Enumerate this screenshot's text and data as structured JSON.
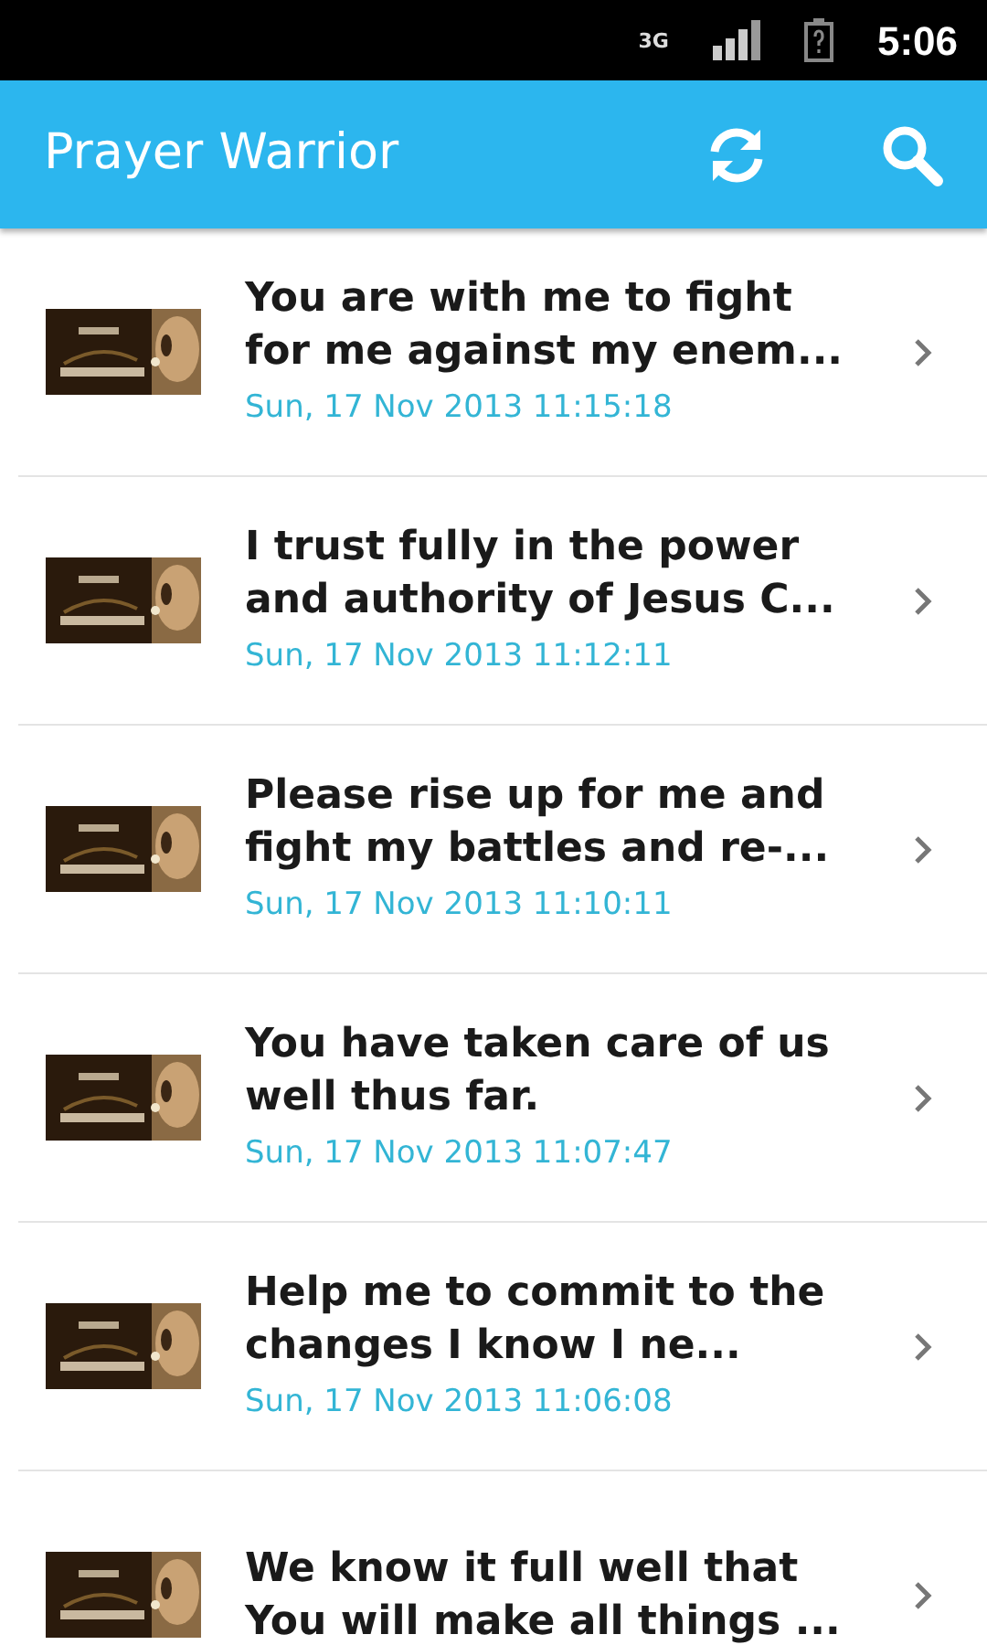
{
  "status_bar": {
    "network": "3G",
    "time": "5:06"
  },
  "app_bar": {
    "title": "Prayer Warrior"
  },
  "prayers": [
    {
      "title": "You are with me to fight for me against my enem...",
      "date": "Sun, 17 Nov 2013 11:15:18"
    },
    {
      "title": "I trust fully in the power and authority of Jesus C...",
      "date": "Sun, 17 Nov 2013 11:12:11"
    },
    {
      "title": "Please rise up for me and fight my battles and re-...",
      "date": "Sun, 17 Nov 2013 11:10:11"
    },
    {
      "title": "You have taken care of us well thus far.",
      "date": "Sun, 17 Nov 2013 11:07:47"
    },
    {
      "title": "Help me to commit to the changes I know I ne...",
      "date": "Sun, 17 Nov 2013 11:06:08"
    },
    {
      "title": "We know it full well that You will make all things ..."
    }
  ]
}
